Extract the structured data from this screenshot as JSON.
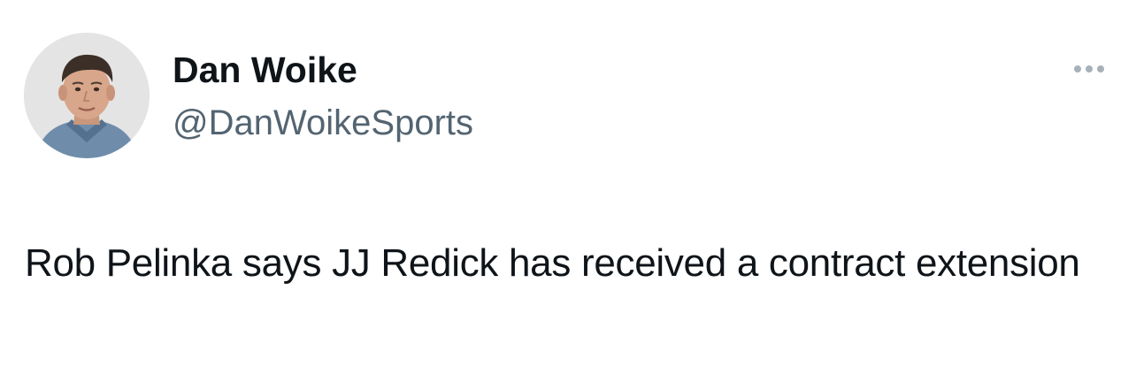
{
  "tweet": {
    "author": {
      "display_name": "Dan Woike",
      "handle": "@DanWoikeSports"
    },
    "text": "Rob Pelinka says JJ Redick has received a contract extension",
    "icons": {
      "more": "more-horizontal-icon"
    },
    "colors": {
      "text": "#0f1419",
      "secondary": "#536471",
      "more_dots": "#a7b1ba"
    }
  }
}
